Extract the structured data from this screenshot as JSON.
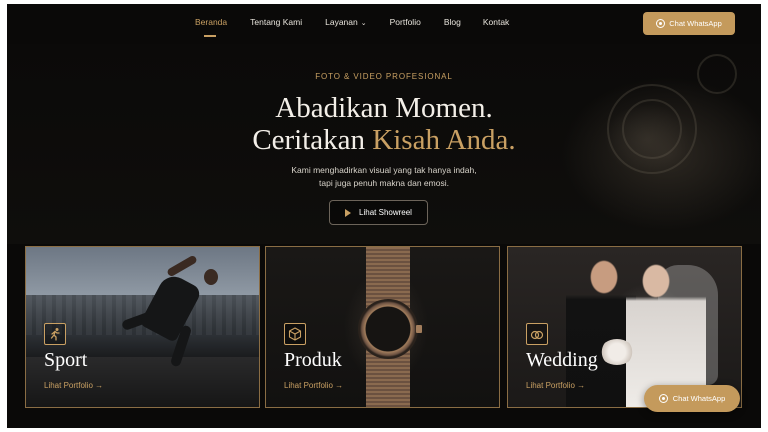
{
  "nav": {
    "items": [
      {
        "label": "Beranda",
        "active": true
      },
      {
        "label": "Tentang Kami"
      },
      {
        "label": "Layanan",
        "dropdown": true
      },
      {
        "label": "Portfolio"
      },
      {
        "label": "Blog"
      },
      {
        "label": "Kontak"
      }
    ],
    "cta_label": "Chat WhatsApp",
    "cta_icon": "whatsapp-icon"
  },
  "hero": {
    "eyebrow": "FOTO & VIDEO PROFESIONAL",
    "headline_line1": "Abadikan Momen.",
    "headline_line2_prefix": "Ceritakan ",
    "headline_line2_accent": "Kisah Anda.",
    "sub_line1": "Kami menghadirkan visual yang tak hanya indah,",
    "sub_line2": "tapi juga penuh makna dan emosi.",
    "button_label": "Lihat Showreel",
    "button_icon": "play-icon"
  },
  "cards": [
    {
      "title": "Sport",
      "link": "Lihat Portfolio →",
      "icon": "runner-icon"
    },
    {
      "title": "Produk",
      "link": "Lihat Portfolio →",
      "icon": "box-icon"
    },
    {
      "title": "Wedding",
      "link": "Lihat Portfolio →",
      "icon": "rings-icon"
    }
  ],
  "floating_cta": {
    "label": "Chat WhatsApp",
    "icon": "whatsapp-icon"
  },
  "colors": {
    "accent": "#c9a063",
    "background": "#0a0908",
    "button": "#c49a5c"
  }
}
